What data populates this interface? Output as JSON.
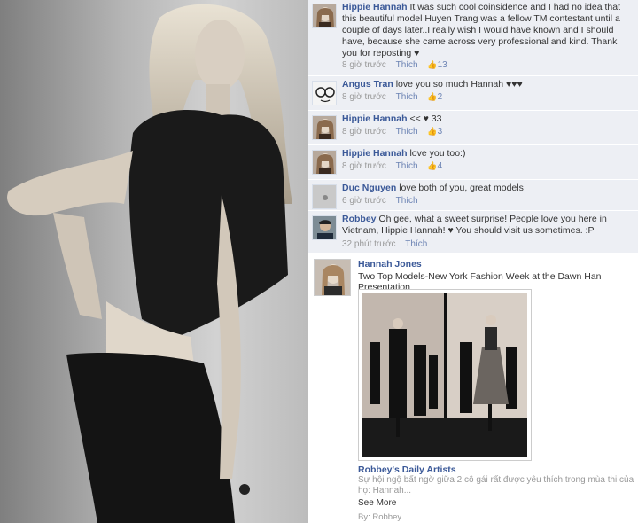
{
  "comments": [
    {
      "author": "Hippie Hannah",
      "text": "It was such cool coinsidence and I had no idea that this beautiful model Huyen Trang was a fellow TM contestant until a couple of days later..I really wish I would have known and I should have, because she came across very professional and kind. Thank you for reposting ♥",
      "time": "8 giờ trước",
      "like_label": "Thích",
      "likes": "13",
      "avatar_icon": "woman-portrait-icon"
    },
    {
      "author": "Angus Tran",
      "text": "love you so much Hannah ♥♥♥",
      "time": "8 giờ trước",
      "like_label": "Thích",
      "likes": "2",
      "avatar_icon": "glasses-face-icon"
    },
    {
      "author": "Hippie Hannah",
      "text": "<< ♥ 33",
      "time": "8 giờ trước",
      "like_label": "Thích",
      "likes": "3",
      "avatar_icon": "woman-portrait-icon"
    },
    {
      "author": "Hippie Hannah",
      "text": "love you too:)",
      "time": "8 giờ trước",
      "like_label": "Thích",
      "likes": "4",
      "avatar_icon": "woman-portrait-icon"
    },
    {
      "author": "Duc Nguyen",
      "text": "love both of you, great models",
      "time": "6 giờ trước",
      "like_label": "Thích",
      "likes": "",
      "avatar_icon": "generic-avatar-icon"
    },
    {
      "author": "Robbey",
      "text": "Oh gee, what a sweet surprise! People love you here in Vietnam, Hippie Hannah! ♥ You should visit us sometimes. :P",
      "time": "32 phút trước",
      "like_label": "Thích",
      "likes": "",
      "avatar_icon": "man-portrait-icon"
    }
  ],
  "post": {
    "author": "Hannah Jones",
    "text": "Two Top Models-New York Fashion Week at the Dawn Han Presentation",
    "link_title": "Robbey's Daily Artists",
    "link_desc": "Sự hội ngộ bất ngờ giữa 2 cô gái rất được yêu thích trong mùa thi của họ: Hannah...",
    "see_more": "See More",
    "by": "By: Robbey"
  },
  "icons": {
    "thumb": "thumbs-up-icon"
  },
  "colors": {
    "fb_blue": "#3b5998",
    "link_blue": "#6d84b4",
    "comment_bg": "#edeff4"
  }
}
